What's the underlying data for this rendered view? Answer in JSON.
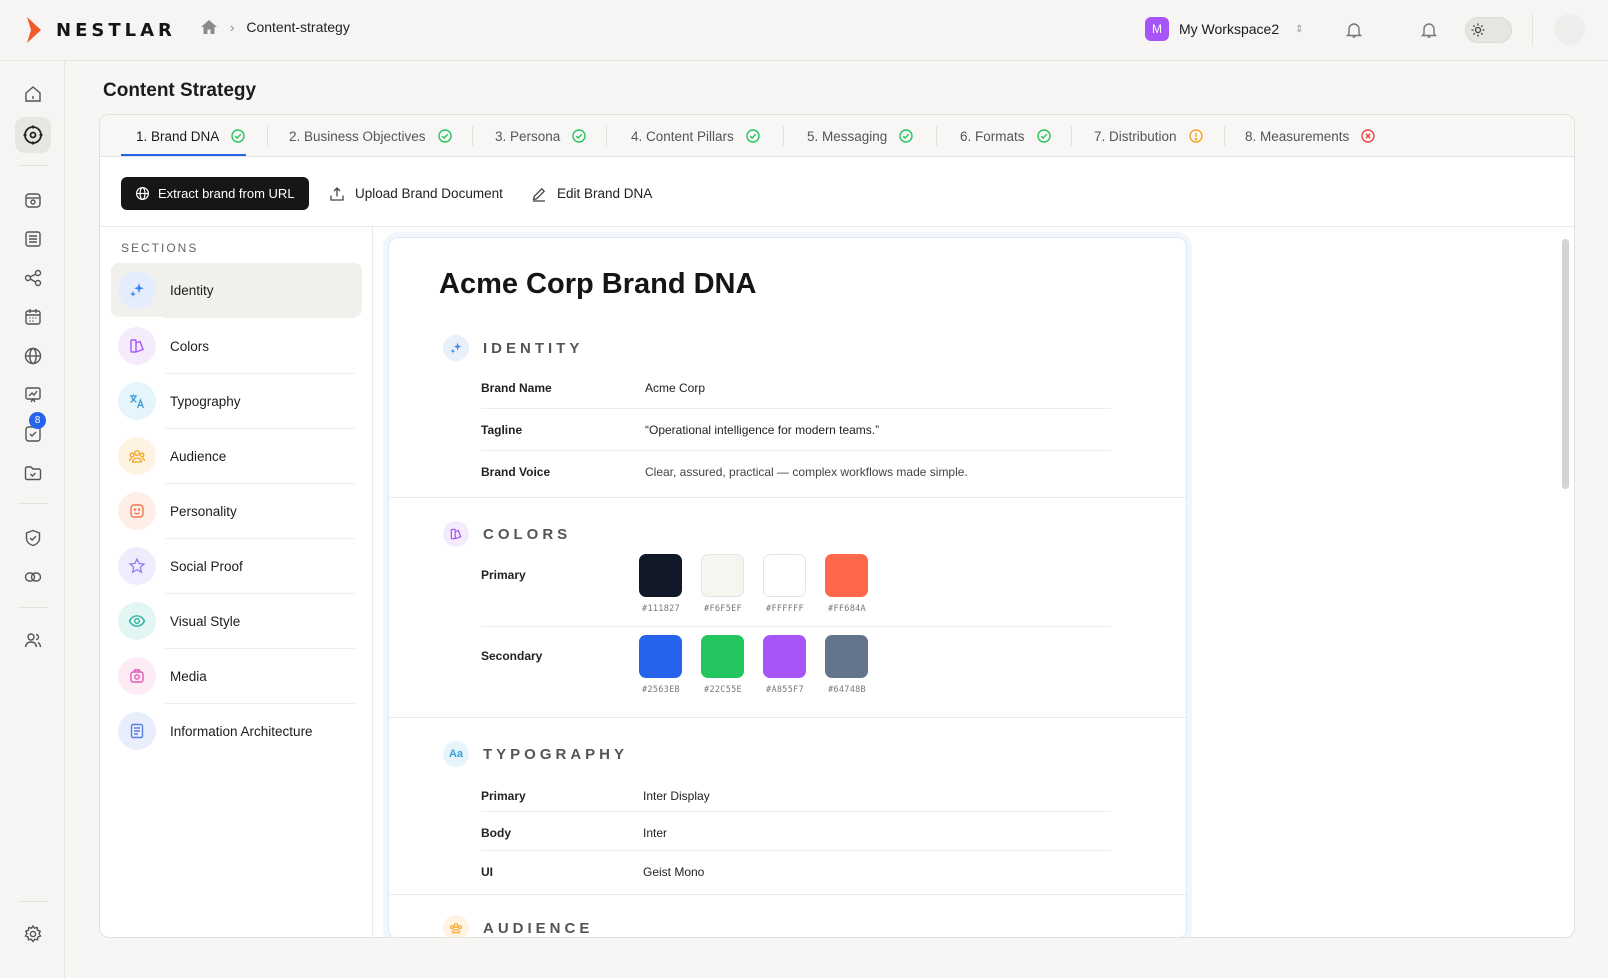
{
  "app": {
    "brand": "NESTLAR",
    "brand_color": "#f05a28"
  },
  "breadcrumb": {
    "home_icon": "home-icon",
    "current": "Content-strategy"
  },
  "workspace": {
    "initial": "M",
    "name": "My Workspace2",
    "color": "#a855f7"
  },
  "rail": {
    "badge_count": "8",
    "badge_color": "#2563eb"
  },
  "page": {
    "title": "Content Strategy"
  },
  "tabs": [
    {
      "label": "1. Brand DNA",
      "status": "done"
    },
    {
      "label": "2. Business Objectives",
      "status": "done"
    },
    {
      "label": "3. Persona",
      "status": "done"
    },
    {
      "label": "4. Content Pillars",
      "status": "done"
    },
    {
      "label": "5. Messaging",
      "status": "done"
    },
    {
      "label": "6. Formats",
      "status": "done"
    },
    {
      "label": "7. Distribution",
      "status": "warning"
    },
    {
      "label": "8. Measurements",
      "status": "error"
    }
  ],
  "actions": {
    "extract": "Extract brand from URL",
    "upload": "Upload Brand Document",
    "edit": "Edit Brand DNA"
  },
  "sections": {
    "label": "SECTIONS",
    "items": [
      {
        "label": "Identity",
        "icon": "sparkle-icon"
      },
      {
        "label": "Colors",
        "icon": "palette-icon"
      },
      {
        "label": "Typography",
        "icon": "translate-icon"
      },
      {
        "label": "Audience",
        "icon": "users-icon"
      },
      {
        "label": "Personality",
        "icon": "smile-icon"
      },
      {
        "label": "Social Proof",
        "icon": "star-icon"
      },
      {
        "label": "Visual Style",
        "icon": "eye-icon"
      },
      {
        "label": "Media",
        "icon": "camera-icon"
      },
      {
        "label": "Information Architecture",
        "icon": "document-icon"
      }
    ]
  },
  "doc": {
    "title": "Acme Corp Brand DNA",
    "identity": {
      "title": "IDENTITY",
      "rows": [
        {
          "label": "Brand Name",
          "value": "Acme Corp"
        },
        {
          "label": "Tagline",
          "value": "“Operational intelligence for modern teams.”"
        },
        {
          "label": "Brand Voice",
          "value": "Clear, assured, practical — complex workflows made simple."
        }
      ]
    },
    "colors": {
      "title": "COLORS",
      "primary_label": "Primary",
      "secondary_label": "Secondary",
      "primary": [
        "#111827",
        "#F6F5EF",
        "#FFFFFF",
        "#FF684A"
      ],
      "secondary": [
        "#2563EB",
        "#22C55E",
        "#A855F7",
        "#64748B"
      ]
    },
    "typography": {
      "title": "TYPOGRAPHY",
      "rows": [
        {
          "label": "Primary",
          "value": "Inter Display"
        },
        {
          "label": "Body",
          "value": "Inter"
        },
        {
          "label": "UI",
          "value": "Geist Mono"
        }
      ]
    },
    "audience": {
      "title": "AUDIENCE"
    }
  }
}
